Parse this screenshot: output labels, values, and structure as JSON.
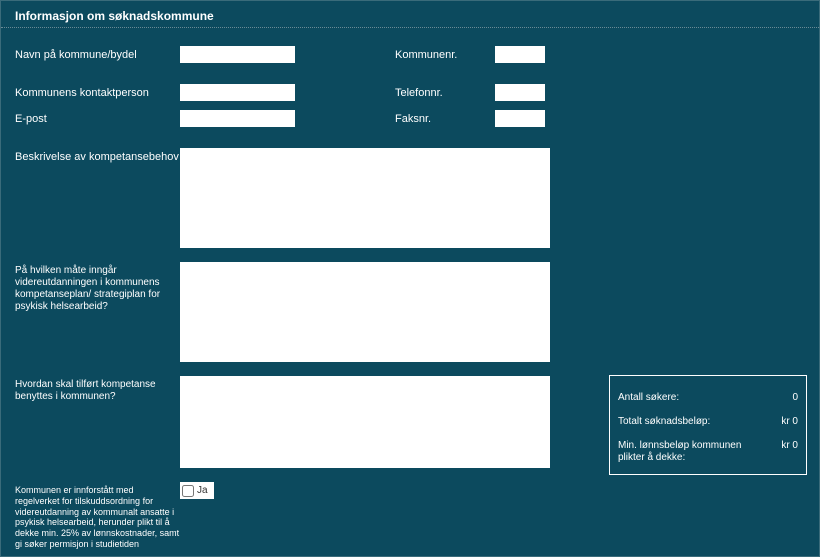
{
  "header": {
    "title": "Informasjon om søknadskommune"
  },
  "fields": {
    "navn_label": "Navn på kommune/bydel",
    "navn_value": "",
    "kommunenr_label": "Kommunenr.",
    "kommunenr_value": "",
    "kontakt_label": "Kommunens kontaktperson",
    "kontakt_value": "",
    "telefon_label": "Telefonnr.",
    "telefon_value": "",
    "epost_label": "E-post",
    "epost_value": "",
    "faks_label": "Faksnr.",
    "faks_value": "",
    "beskrivelse_label": "Beskrivelse av kompetansebehov",
    "beskrivelse_value": "",
    "plan_label": "På hvilken måte inngår videreutdanningen i kommunens kompetanseplan/ strategiplan for psykisk helsearbeid?",
    "plan_value": "",
    "benyttes_label": "Hvordan skal tilført kompetanse benyttes i kommunen?",
    "benyttes_value": "",
    "innforstatt_label": "Kommunen er innforstått med regelverket for tilskuddsordning for videreutdanning av kommunalt ansatte i psykisk helsearbeid, herunder plikt til å dekke min. 25% av lønnskostnader, samt gi søker permisjon i studietiden",
    "ja_label": "Ja"
  },
  "summary": {
    "antall_label": "Antall søkere:",
    "antall_value": "0",
    "total_label": "Totalt søknadsbeløp:",
    "total_value": "kr 0",
    "min_label": "Min. lønnsbeløp kommunen plikter å dekke:",
    "min_value": "kr 0"
  }
}
